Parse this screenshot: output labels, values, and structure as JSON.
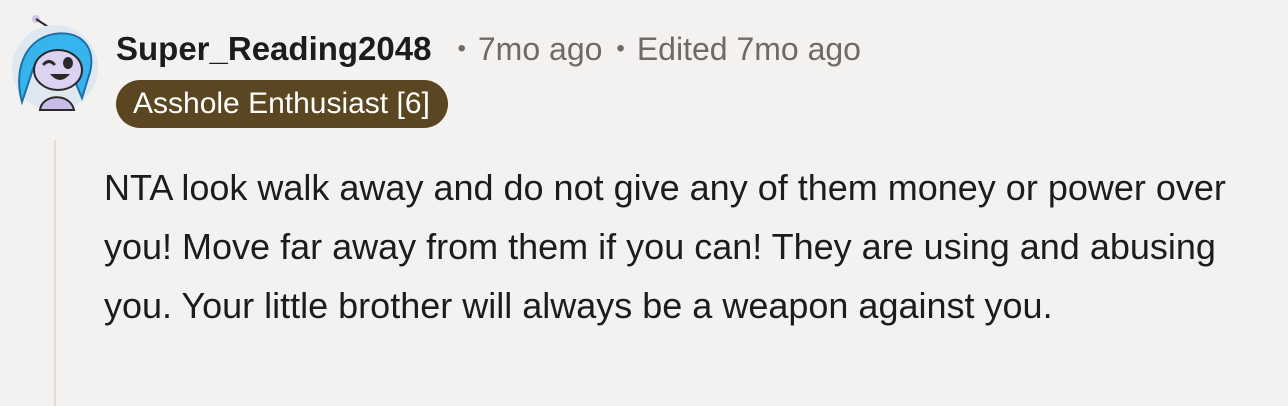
{
  "comment": {
    "author": "Super_Reading2048",
    "timestamp": "7mo ago",
    "edited": "Edited 7mo ago",
    "separator": "•",
    "flair": "Asshole Enthusiast [6]",
    "flair_color": "#5a4620",
    "body": "NTA look walk away and do not give any of them money or power over you! Move far away from them if you can! They are using and abusing you. Your little brother will always be a weapon against you."
  },
  "avatar": {
    "icon": "snoo-avatar-icon",
    "hair_color": "#37b4ee"
  }
}
